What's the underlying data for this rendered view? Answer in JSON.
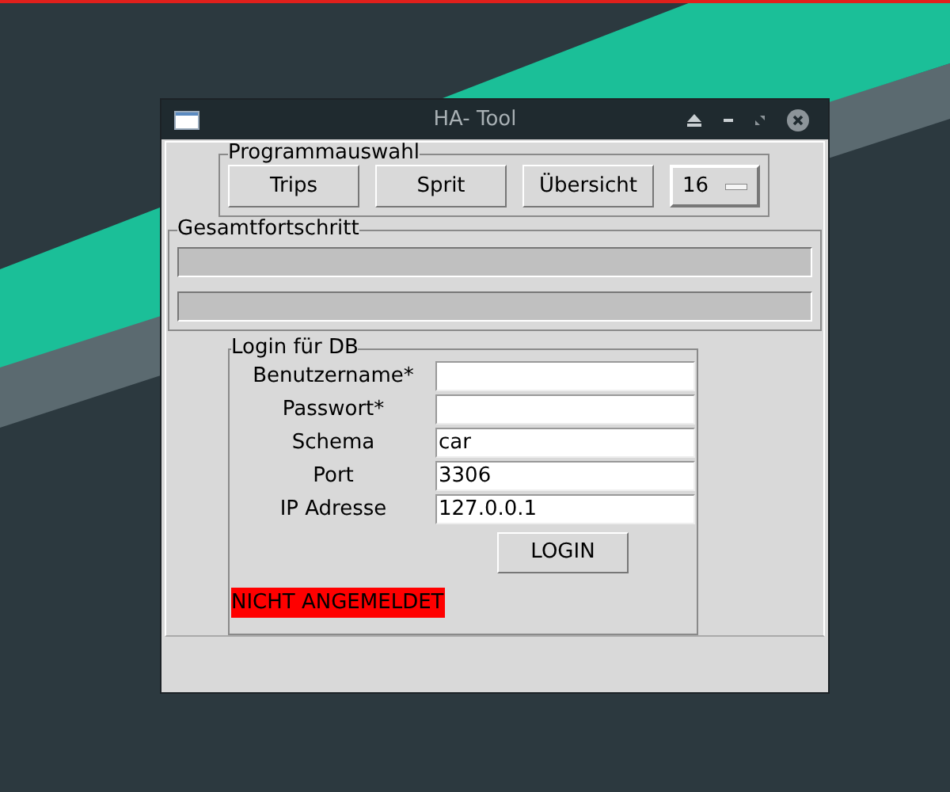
{
  "window": {
    "title": "HA- Tool"
  },
  "program_selection": {
    "title": "Programmauswahl",
    "buttons": [
      "Trips",
      "Sprit",
      "Übersicht"
    ],
    "dropdown": {
      "value": "16"
    }
  },
  "overall_progress": {
    "title": "Gesamtfortschritt",
    "bars": [
      {
        "level": 0
      },
      {
        "level": 0
      }
    ]
  },
  "login": {
    "title": "Login für DB",
    "fields": [
      {
        "label": "Benutzername*"
      },
      {
        "label": "Passwort*"
      },
      {
        "label": "Schema",
        "value": "car"
      },
      {
        "label": "Port",
        "value": "3306"
      },
      {
        "label": "IP Adresse",
        "value": "127.0.0.1"
      }
    ],
    "button": "LOGIN",
    "status": {
      "text": "NICHT ANGEMELDET",
      "color": "#ff0000"
    }
  }
}
